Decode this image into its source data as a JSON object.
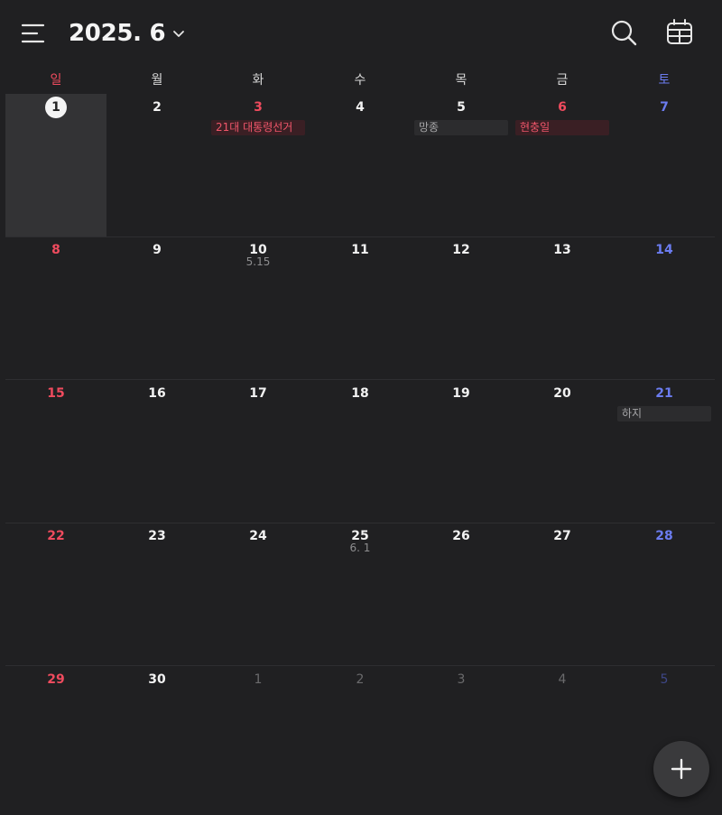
{
  "header": {
    "title": "2025. 6"
  },
  "weekdays": [
    "일",
    "월",
    "화",
    "수",
    "목",
    "금",
    "토"
  ],
  "colors": {
    "background": "#202022",
    "sunday": "#ef4b5e",
    "saturday": "#6b7cf0",
    "holiday_chip_bg": "#3a1f24",
    "event_chip_bg": "#2c2c2e"
  },
  "weeks": [
    {
      "days": [
        {
          "day": "1",
          "today": true,
          "selected": true
        },
        {
          "day": "2"
        },
        {
          "day": "3",
          "holiday": true,
          "event": "21대 대통령선거",
          "event_style": "red"
        },
        {
          "day": "4"
        },
        {
          "day": "5",
          "event": "망종",
          "event_style": "gray"
        },
        {
          "day": "6",
          "holiday": true,
          "event": "현충일",
          "event_style": "red"
        },
        {
          "day": "7"
        }
      ]
    },
    {
      "days": [
        {
          "day": "8"
        },
        {
          "day": "9"
        },
        {
          "day": "10",
          "lunar": "5.15"
        },
        {
          "day": "11"
        },
        {
          "day": "12"
        },
        {
          "day": "13"
        },
        {
          "day": "14"
        }
      ]
    },
    {
      "days": [
        {
          "day": "15"
        },
        {
          "day": "16"
        },
        {
          "day": "17"
        },
        {
          "day": "18"
        },
        {
          "day": "19"
        },
        {
          "day": "20"
        },
        {
          "day": "21",
          "event": "하지",
          "event_style": "gray"
        }
      ]
    },
    {
      "days": [
        {
          "day": "22"
        },
        {
          "day": "23"
        },
        {
          "day": "24"
        },
        {
          "day": "25",
          "lunar": "6. 1"
        },
        {
          "day": "26"
        },
        {
          "day": "27"
        },
        {
          "day": "28"
        }
      ]
    },
    {
      "days": [
        {
          "day": "29"
        },
        {
          "day": "30"
        },
        {
          "day": "1",
          "other": true
        },
        {
          "day": "2",
          "other": true
        },
        {
          "day": "3",
          "other": true
        },
        {
          "day": "4",
          "other": true
        },
        {
          "day": "5",
          "other": true
        }
      ]
    }
  ],
  "icons": {
    "menu": "hamburger-menu-icon",
    "dropdown": "chevron-down-icon",
    "search": "search-icon",
    "calendar_view": "calendar-grid-icon",
    "add": "plus-icon"
  }
}
